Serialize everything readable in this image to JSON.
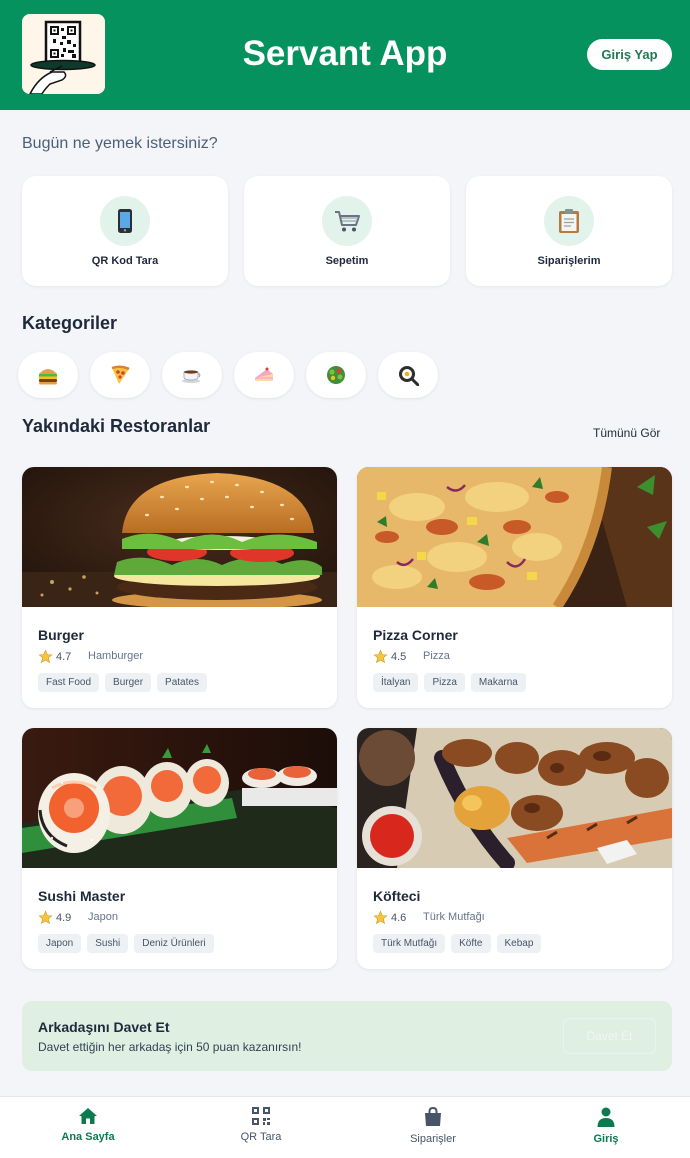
{
  "header": {
    "title": "Servant App",
    "login_label": "Giriş Yap",
    "brand_color": "#06925e"
  },
  "greeting": "Bugün ne yemek istersiniz?",
  "quick_actions": [
    {
      "label": "QR Kod Tara",
      "icon": "mobile-phone-icon"
    },
    {
      "label": "Sepetim",
      "icon": "shopping-cart-icon"
    },
    {
      "label": "Siparişlerim",
      "icon": "clipboard-icon"
    }
  ],
  "categories": {
    "title": "Kategoriler",
    "items": [
      {
        "icon": "hamburger-icon"
      },
      {
        "icon": "pizza-slice-icon"
      },
      {
        "icon": "coffee-cup-icon"
      },
      {
        "icon": "cake-slice-icon"
      },
      {
        "icon": "salad-icon"
      },
      {
        "icon": "fried-egg-pan-icon"
      }
    ]
  },
  "restaurants": {
    "title": "Yakındaki Restoranlar",
    "see_all": "Tümünü Gör",
    "items": [
      {
        "name": "Burger",
        "rating": "4.7",
        "cuisine": "Hamburger",
        "tags": [
          "Fast Food",
          "Burger",
          "Patates"
        ],
        "image": "burger-photo"
      },
      {
        "name": "Pizza Corner",
        "rating": "4.5",
        "cuisine": "Pizza",
        "tags": [
          "İtalyan",
          "Pizza",
          "Makarna"
        ],
        "image": "pizza-photo"
      },
      {
        "name": "Sushi Master",
        "rating": "4.9",
        "cuisine": "Japon",
        "tags": [
          "Japon",
          "Sushi",
          "Deniz Ürünleri"
        ],
        "image": "sushi-photo"
      },
      {
        "name": "Köfteci",
        "rating": "4.6",
        "cuisine": "Türk Mutfağı",
        "tags": [
          "Türk Mutfağı",
          "Köfte",
          "Kebap"
        ],
        "image": "kebab-photo"
      }
    ]
  },
  "invite": {
    "title": "Arkadaşını Davet Et",
    "text": "Davet ettiğin her arkadaş için 50 puan kazanırsın!",
    "button": "Davet Et"
  },
  "bottom_nav": [
    {
      "label": "Ana Sayfa",
      "icon": "home-icon",
      "active": true
    },
    {
      "label": "QR Tara",
      "icon": "qr-code-icon",
      "active": false
    },
    {
      "label": "Siparişler",
      "icon": "shopping-bag-icon",
      "active": false
    },
    {
      "label": "Giriş",
      "icon": "user-icon",
      "active": true
    }
  ]
}
